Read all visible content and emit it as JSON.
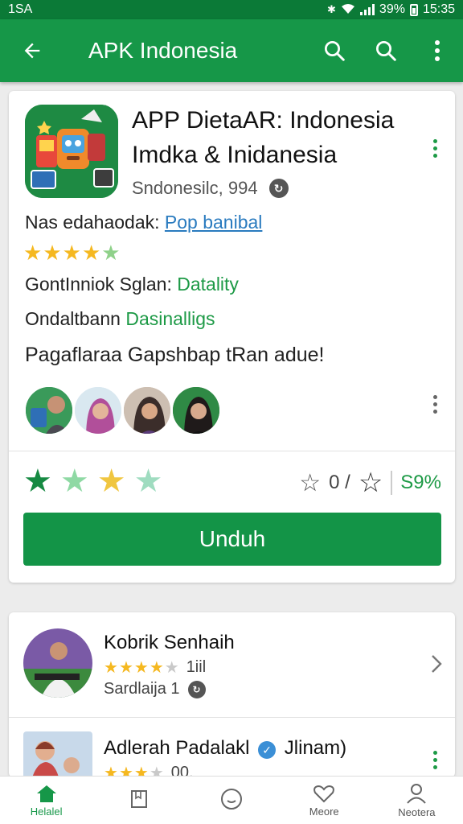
{
  "status_bar": {
    "time_left": "1SA",
    "time_right": "15:35",
    "battery": "39%"
  },
  "app_bar": {
    "title": "APK Indonesia"
  },
  "app": {
    "title": "APP DietaAR: Indonesia Imdka & Inidanesia",
    "developer": "Sndonesilc, 994",
    "info_line_prefix": "Nas edahaodak:",
    "info_line_link": "Pop banibal",
    "rating_text": "4.5",
    "category_label": "GontInniok Sglan:",
    "category_value": "Datality",
    "sub_label": "Ondaltbann",
    "sub_value": "Dasinalligs",
    "tagline": "Pagaflaraa Gapshbap tRan adue!",
    "rate_count": "0 /",
    "rate_percent": "S9%"
  },
  "download_button": {
    "label": "Unduh"
  },
  "reviews": [
    {
      "name": "Kobrik Senhaih",
      "rating": 4,
      "count": "1iil",
      "sub": "Sardlaija 1"
    },
    {
      "name": "Adlerah Padalakl",
      "rating": 3,
      "count": "00.",
      "badge": "Jlinam)"
    }
  ],
  "bottom_nav": [
    {
      "label": "Helalel",
      "icon": "home-icon"
    },
    {
      "label": "",
      "icon": "book-icon"
    },
    {
      "label": "",
      "icon": "compass-icon"
    },
    {
      "label": "Meore",
      "icon": "heart-icon"
    },
    {
      "label": "Neotera",
      "icon": "person-icon"
    }
  ],
  "colors": {
    "primary": "#169748",
    "status_bar": "#0b7a37",
    "button": "#139447",
    "star_gold": "#f5b820",
    "link": "#2a7bbf"
  }
}
